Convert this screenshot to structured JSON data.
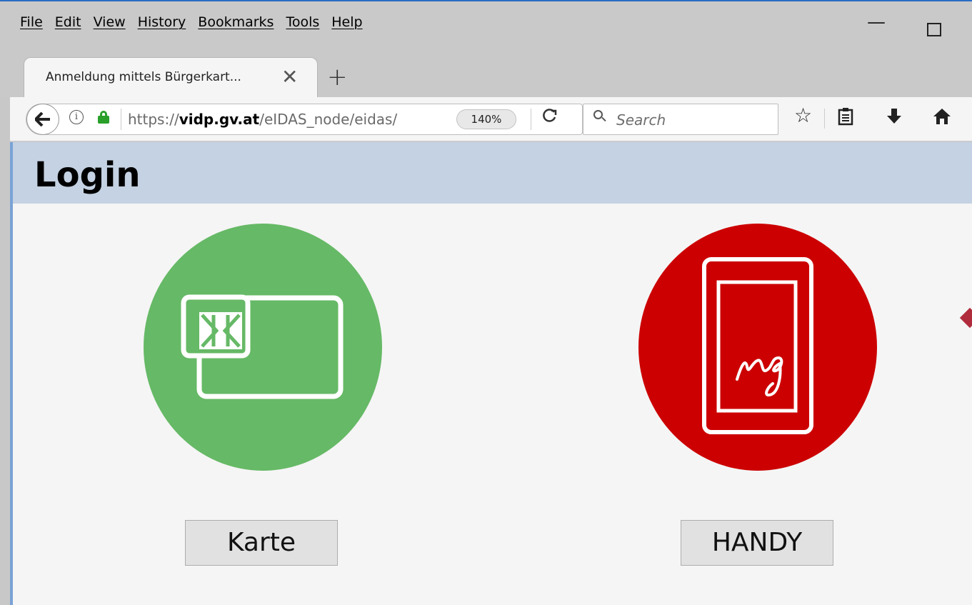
{
  "menubar": {
    "items": [
      "File",
      "Edit",
      "View",
      "History",
      "Bookmarks",
      "Tools",
      "Help"
    ]
  },
  "tab": {
    "title": "Anmeldung mittels Bürgerkart...",
    "close": "✕",
    "new_tab": "+"
  },
  "nav": {
    "url_scheme": "https://",
    "url_host": "vidp.gv.at",
    "url_path": "/eIDAS_node/eidas/",
    "zoom": "140%",
    "search_placeholder": "Search"
  },
  "page": {
    "title": "Login",
    "card_button": "Karte",
    "mobile_button": "HANDY",
    "card_icon_color": "#66b966",
    "mobile_icon_color": "#cc0000",
    "mobile_icon_text": "sig"
  },
  "icons": {
    "back": "arrow-left-icon",
    "info": "info-icon",
    "lock": "lock-icon",
    "reload": "reload-icon",
    "search": "search-icon",
    "bookmark": "star-icon",
    "reader": "reader-view-icon",
    "download": "download-icon",
    "home": "home-icon"
  }
}
